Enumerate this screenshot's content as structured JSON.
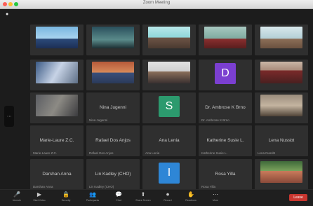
{
  "window": {
    "title": "Zoom Meeting"
  },
  "tiles": [
    {
      "kind": "video",
      "bg": "linear-gradient(#79b6e0 0%,#a9d4ef 55%,#2c4a7a 56%,#1c2f55 100%)",
      "name": ""
    },
    {
      "kind": "video",
      "bg": "linear-gradient(#2a4f5c,#5a8a8a 60%,#1d2f33)",
      "name": ""
    },
    {
      "kind": "video",
      "bg": "linear-gradient(#b9e8ea,#8fd6d9 50%,#6d5446 51%,#4a3a30 100%)",
      "name": ""
    },
    {
      "kind": "video",
      "bg": "linear-gradient(#a8c8c0,#7eaaa0 55%,#8a2f2f 56%,#5a1e1e 100%)",
      "name": ""
    },
    {
      "kind": "video",
      "bg": "linear-gradient(#d8e8ec,#b3cfd6 55%,#8c6e58 56%,#6b523f 100%)",
      "name": ""
    },
    {
      "kind": "video",
      "bg": "linear-gradient(120deg,#3b5a85,#c7d3e6 50%,#5e6f86)",
      "name": ""
    },
    {
      "kind": "video",
      "bg": "linear-gradient(#b65a3a,#d78a5a 50%,#3a4f7a 51%,#2a3a5a)",
      "name": ""
    },
    {
      "kind": "video",
      "bg": "linear-gradient(#e2e2e2,#cfcfcf 45%,#8a6e5a 46%,#3a3030)",
      "name": ""
    },
    {
      "kind": "letter",
      "letter": "D",
      "color": "#7b3fd0",
      "name": ""
    },
    {
      "kind": "video",
      "bg": "linear-gradient(#c9b6a6,#a88a7a 40%,#7a2a2a 41%,#4a2020)",
      "name": ""
    },
    {
      "kind": "video",
      "bg": "linear-gradient(120deg,#5b5d62,#8c8a84 50%,#3b3b3e)",
      "name": ""
    },
    {
      "kind": "text",
      "center": "Nina Jugenni",
      "name": "Nina Jugenni"
    },
    {
      "kind": "letter",
      "letter": "S",
      "color": "#2c9a6e",
      "name": ""
    },
    {
      "kind": "text",
      "center": "Dr. Ambrose K Brno",
      "name": "Dr. Ambrose K Brno"
    },
    {
      "kind": "video",
      "bg": "linear-gradient(#9a8c7c,#c4b4a0 50%,#4f4337)",
      "name": ""
    },
    {
      "kind": "text",
      "center": "Marie-Laure Z.C.",
      "name": "Marie-Laure Z.C."
    },
    {
      "kind": "text",
      "center": "Rafael Dos Anjos",
      "name": "Rafael Dos Anjos"
    },
    {
      "kind": "text",
      "center": "Ana Lenia",
      "name": "Ana Lenia"
    },
    {
      "kind": "text",
      "center": "Katherine Susie L.",
      "name": "Katherine Susie L."
    },
    {
      "kind": "text",
      "center": "Lena Nussbt",
      "name": "Lena Nussbt"
    },
    {
      "kind": "text",
      "center": "Darshan Anna",
      "name": "Darshan Anna"
    },
    {
      "kind": "text",
      "center": "Lin Kadley (CHO)",
      "name": "Lin Kadley (CHO)"
    },
    {
      "kind": "letter",
      "letter": "I",
      "color": "#2e86d6",
      "name": ""
    },
    {
      "kind": "text",
      "center": "Rosa Yilla",
      "name": "Rosa Yilla"
    },
    {
      "kind": "video",
      "bg": "linear-gradient(#3f6a3a,#7aa25c 45%,#c87a5a 46%,#8a4a3a)",
      "name": ""
    }
  ],
  "toolbar": {
    "items": [
      {
        "icon": "🎤",
        "label": "Unmute"
      },
      {
        "icon": "▶",
        "label": "Start Video"
      },
      {
        "icon": "🔒",
        "label": "Security"
      },
      {
        "icon": "👥",
        "label": "Participants"
      },
      {
        "icon": "💬",
        "label": "Chat"
      },
      {
        "icon": "⬆",
        "label": "Share Screen"
      },
      {
        "icon": "⏺",
        "label": "Record"
      },
      {
        "icon": "✋",
        "label": "Reactions"
      },
      {
        "icon": "⋯",
        "label": "More"
      }
    ],
    "end_label": "Leave"
  },
  "side_tab": "⋮"
}
